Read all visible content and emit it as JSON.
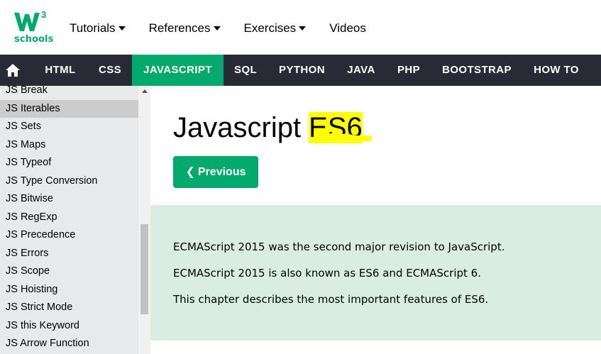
{
  "brand": {
    "logo_text": "schools",
    "logo_sup": "3"
  },
  "topnav": [
    {
      "label": "Tutorials",
      "has_caret": true
    },
    {
      "label": "References",
      "has_caret": true
    },
    {
      "label": "Exercises",
      "has_caret": true
    },
    {
      "label": "Videos",
      "has_caret": false
    }
  ],
  "navbar": {
    "home_icon": "home-icon",
    "links": [
      "HTML",
      "CSS",
      "JAVASCRIPT",
      "SQL",
      "PYTHON",
      "JAVA",
      "PHP",
      "BOOTSTRAP",
      "HOW TO"
    ],
    "active": "JAVASCRIPT"
  },
  "sidebar": {
    "items": [
      "JS Break",
      "JS Iterables",
      "JS Sets",
      "JS Maps",
      "JS Typeof",
      "JS Type Conversion",
      "JS Bitwise",
      "JS RegExp",
      "JS Precedence",
      "JS Errors",
      "JS Scope",
      "JS Hoisting",
      "JS Strict Mode",
      "JS this Keyword",
      "JS Arrow Function"
    ],
    "active": "JS Iterables"
  },
  "main": {
    "title_prefix": "Javascript ",
    "title_highlight": "ES6",
    "prev_button": "Previous",
    "paragraphs": [
      "ECMAScript 2015 was the second major revision to JavaScript.",
      "ECMAScript 2015 is also known as ES6 and ECMAScript 6.",
      "This chapter describes the most important features of ES6."
    ]
  },
  "colors": {
    "brand_green": "#04aa6d",
    "navbar_bg": "#282a35",
    "note_bg": "#d9eee1",
    "highlight": "#ffff00"
  }
}
